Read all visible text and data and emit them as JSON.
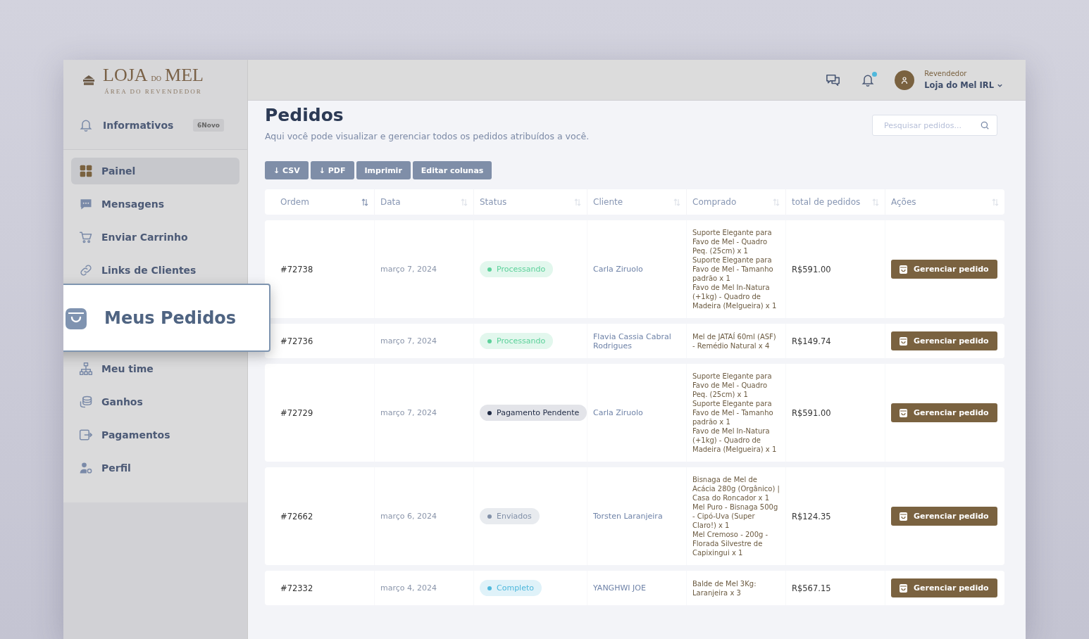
{
  "logo": {
    "words": [
      "LOJA",
      "DO",
      "MEL"
    ],
    "tagline": "ÁREA DO REVENDEDOR"
  },
  "notice": {
    "label": "Informativos",
    "badge": "6Novo"
  },
  "sidebar": {
    "items": [
      {
        "label": "Painel",
        "selected": true,
        "kind": "item"
      },
      {
        "label": "Mensagens",
        "selected": false,
        "kind": "item"
      },
      {
        "label": "Enviar Carrinho",
        "selected": false,
        "kind": "item"
      },
      {
        "label": "Links de Clientes",
        "selected": false,
        "kind": "item"
      },
      {
        "label": "Meus Pedidos",
        "selected": false,
        "kind": "callout"
      },
      {
        "label": "Meu time",
        "selected": false,
        "kind": "item"
      },
      {
        "label": "Ganhos",
        "selected": false,
        "kind": "item"
      },
      {
        "label": "Pagamentos",
        "selected": false,
        "kind": "item"
      },
      {
        "label": "Perfil",
        "selected": false,
        "kind": "item"
      }
    ]
  },
  "topbar": {
    "role": "Revendedor",
    "user": "Loja do Mel IRL",
    "notification_dot": true
  },
  "page": {
    "title": "Pedidos",
    "subtitle": "Aqui você pode visualizar e gerenciar todos os pedidos atribuídos a você.",
    "search": {
      "placeholder": "Pesquisar pedidos..."
    }
  },
  "toolbar": [
    "↓ CSV",
    "↓ PDF",
    "Imprimir",
    "Editar colunas"
  ],
  "table": {
    "columns": [
      "Ordem",
      "Data",
      "Status",
      "Cliente",
      "Comprado",
      "total de pedidos",
      "Ações"
    ],
    "rows": [
      {
        "order": "#72738",
        "date": "março 7, 2024",
        "status": "Processando",
        "color": "#5cd19a",
        "client": "Carla Ziruolo",
        "items": [
          "Suporte Elegante para Favo de Mel - Quadro Peq. (25cm) x 1",
          "Suporte Elegante para Favo de Mel - Tamanho padrão x 1",
          "Favo de Mel In-Natura (+1kg) - Quadro de Madeira (Melgueira) x 1"
        ],
        "total": "R$591.00",
        "action": "Gerenciar pedido"
      },
      {
        "order": "#72736",
        "date": "março 7, 2024",
        "status": "Processando",
        "color": "#5cd19a",
        "client": "Flavia Cassia Cabral Rodrigues",
        "items": [
          "Mel de JATAÍ 60ml (ASF) - Remédio Natural x 4"
        ],
        "total": "R$149.74",
        "action": "Gerenciar pedido"
      },
      {
        "order": "#72729",
        "date": "março 7, 2024",
        "status": "Pagamento Pendente",
        "color": "#1f2a44",
        "client": "Carla Ziruolo",
        "items": [
          "Suporte Elegante para Favo de Mel - Quadro Peq. (25cm) x 1",
          "Suporte Elegante para Favo de Mel - Tamanho padrão x 1",
          "Favo de Mel In-Natura (+1kg) - Quadro de Madeira (Melgueira) x 1"
        ],
        "total": "R$591.00",
        "action": "Gerenciar pedido"
      },
      {
        "order": "#72662",
        "date": "março 6, 2024",
        "status": "Enviados",
        "color": "#8190a8",
        "client": "Torsten Laranjeira",
        "items": [
          "Bisnaga de Mel de Acácia 280g (Orgânico) | Casa do Roncador x 1",
          "Mel Puro - Bisnaga 500g - Cipó-Uva (Super Claro!) x 1",
          "Mel Cremoso - 200g - Florada Silvestre de Capixingui x 1"
        ],
        "total": "R$124.35",
        "action": "Gerenciar pedido"
      },
      {
        "order": "#72332",
        "date": "março 4, 2024",
        "status": "Completo",
        "color": "#4fb8dc",
        "client": "YANGHWI JOE",
        "items": [
          "Balde de Mel 3Kg: Laranjeira x 3"
        ],
        "total": "R$567.15",
        "action": "Gerenciar pedido"
      }
    ]
  }
}
